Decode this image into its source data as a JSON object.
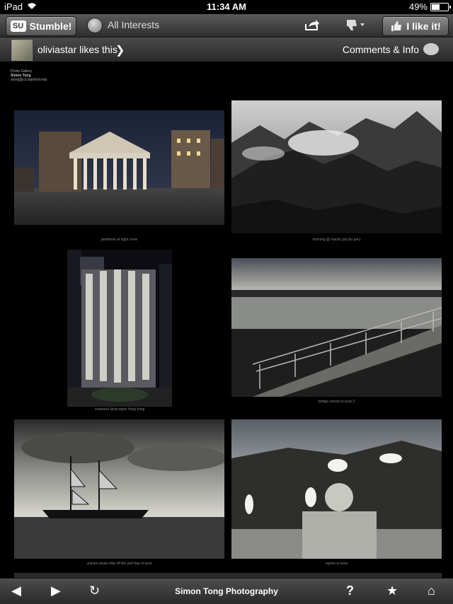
{
  "status": {
    "device": "iPad",
    "time": "11:34 AM",
    "battery": "49%",
    "battery_level": 0.49
  },
  "toolbar": {
    "stumble_label": "Stumble!",
    "logo_text": "SU",
    "interests_label": "All Interests",
    "like_label": "I like it!"
  },
  "likebar": {
    "text": "oliviastar likes this",
    "comments_label": "Comments & Info"
  },
  "gallery": {
    "head_line1": "Photo Gallery",
    "head_line2": "Simon Tong",
    "head_line3": "stong@cs.stanford.edu",
    "captions": [
      "pantheon at night rome",
      "morning @ machu picchu peru",
      "cosumed skyscraper hong kong",
      "bridge sunset st lucia 2",
      "unicorn pirate ship off the port bay st lucia",
      "egrets st lucia"
    ]
  },
  "bottombar": {
    "title": "Simon Tong Photography"
  },
  "colors": {
    "toolbar_top": "#5a5a5a",
    "toolbar_bottom": "#2e2e2e",
    "page_bg": "#000000"
  }
}
